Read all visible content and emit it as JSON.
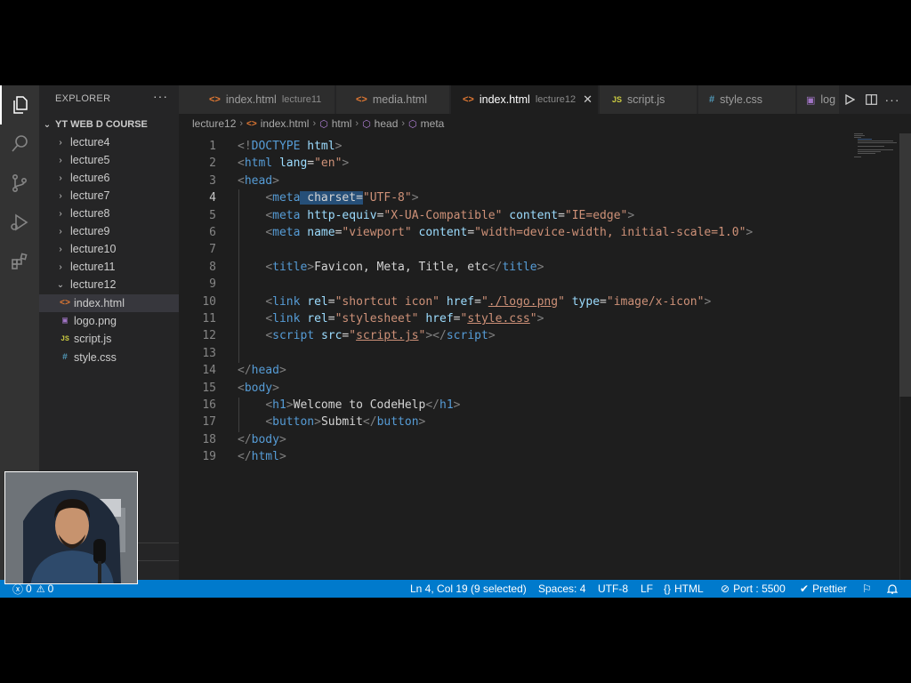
{
  "sidebar": {
    "title": "EXPLORER",
    "more": "···",
    "project": "YT WEB D COURSE",
    "folders": [
      "lecture4",
      "lecture5",
      "lecture6",
      "lecture7",
      "lecture8",
      "lecture9",
      "lecture10",
      "lecture11",
      "lecture12"
    ],
    "files": [
      {
        "name": "index.html",
        "icon": "html-icon",
        "glyph": "<>",
        "color": "#e37933"
      },
      {
        "name": "logo.png",
        "icon": "image-icon",
        "glyph": "▣",
        "color": "#a074c4"
      },
      {
        "name": "script.js",
        "icon": "js-icon",
        "glyph": "JS",
        "color": "#cbcb41"
      },
      {
        "name": "style.css",
        "icon": "css-icon",
        "glyph": "#",
        "color": "#519aba"
      }
    ]
  },
  "tabs": [
    {
      "label": "index.html",
      "desc": "lecture11",
      "glyph": "<>",
      "color": "#e37933",
      "active": false
    },
    {
      "label": "media.html",
      "desc": "",
      "glyph": "<>",
      "color": "#e37933",
      "active": false
    },
    {
      "label": "index.html",
      "desc": "lecture12",
      "glyph": "<>",
      "color": "#e37933",
      "active": true,
      "close": "✕"
    },
    {
      "label": "script.js",
      "desc": "",
      "glyph": "JS",
      "color": "#cbcb41",
      "active": false
    },
    {
      "label": "style.css",
      "desc": "",
      "glyph": "#",
      "color": "#519aba",
      "active": false
    },
    {
      "label": "log",
      "desc": "",
      "glyph": "▣",
      "color": "#a074c4",
      "active": false
    }
  ],
  "breadcrumb": {
    "folder": "lecture12",
    "file": "index.html",
    "html": "html",
    "head": "head",
    "meta": "meta"
  },
  "editor": {
    "lines": [
      {
        "n": "1",
        "tokens": [
          [
            "tg",
            "<!"
          ],
          [
            "tn",
            "DOCTYPE"
          ],
          [
            "tx",
            " "
          ],
          [
            "an",
            "html"
          ],
          [
            "tg",
            ">"
          ]
        ]
      },
      {
        "n": "2",
        "tokens": [
          [
            "tg",
            "<"
          ],
          [
            "tn",
            "html"
          ],
          [
            "tx",
            " "
          ],
          [
            "an",
            "lang"
          ],
          [
            "tx",
            "="
          ],
          [
            "av",
            "\"en\""
          ],
          [
            "tg",
            ">"
          ]
        ]
      },
      {
        "n": "3",
        "tokens": [
          [
            "tg",
            "<"
          ],
          [
            "tn",
            "head"
          ],
          [
            "tg",
            ">"
          ]
        ]
      },
      {
        "n": "4",
        "tokens": [
          [
            "tx",
            "    "
          ],
          [
            "tg",
            "<"
          ],
          [
            "tn",
            "meta"
          ],
          [
            "sel",
            " charset="
          ],
          [
            "av",
            "\"UTF-8\""
          ],
          [
            "tg",
            ">"
          ]
        ]
      },
      {
        "n": "5",
        "tokens": [
          [
            "tx",
            "    "
          ],
          [
            "tg",
            "<"
          ],
          [
            "tn",
            "meta"
          ],
          [
            "tx",
            " "
          ],
          [
            "an",
            "http-equiv"
          ],
          [
            "tx",
            "="
          ],
          [
            "av",
            "\"X-UA-Compatible\""
          ],
          [
            "tx",
            " "
          ],
          [
            "an",
            "content"
          ],
          [
            "tx",
            "="
          ],
          [
            "av",
            "\"IE=edge\""
          ],
          [
            "tg",
            ">"
          ]
        ]
      },
      {
        "n": "6",
        "tokens": [
          [
            "tx",
            "    "
          ],
          [
            "tg",
            "<"
          ],
          [
            "tn",
            "meta"
          ],
          [
            "tx",
            " "
          ],
          [
            "an",
            "name"
          ],
          [
            "tx",
            "="
          ],
          [
            "av",
            "\"viewport\""
          ],
          [
            "tx",
            " "
          ],
          [
            "an",
            "content"
          ],
          [
            "tx",
            "="
          ],
          [
            "av",
            "\"width=device-width, initial-scale=1.0\""
          ],
          [
            "tg",
            ">"
          ]
        ]
      },
      {
        "n": "7",
        "tokens": []
      },
      {
        "n": "8",
        "tokens": [
          [
            "tx",
            "    "
          ],
          [
            "tg",
            "<"
          ],
          [
            "tn",
            "title"
          ],
          [
            "tg",
            ">"
          ],
          [
            "tx",
            "Favicon, Meta, Title, etc"
          ],
          [
            "tg",
            "</"
          ],
          [
            "tn",
            "title"
          ],
          [
            "tg",
            ">"
          ]
        ]
      },
      {
        "n": "9",
        "tokens": []
      },
      {
        "n": "10",
        "tokens": [
          [
            "tx",
            "    "
          ],
          [
            "tg",
            "<"
          ],
          [
            "tn",
            "link"
          ],
          [
            "tx",
            " "
          ],
          [
            "an",
            "rel"
          ],
          [
            "tx",
            "="
          ],
          [
            "av",
            "\"shortcut icon\""
          ],
          [
            "tx",
            " "
          ],
          [
            "an",
            "href"
          ],
          [
            "tx",
            "="
          ],
          [
            "av",
            "\""
          ],
          [
            "lk",
            "./logo.png"
          ],
          [
            "av",
            "\""
          ],
          [
            "tx",
            " "
          ],
          [
            "an",
            "type"
          ],
          [
            "tx",
            "="
          ],
          [
            "av",
            "\"image/x-icon\""
          ],
          [
            "tg",
            ">"
          ]
        ]
      },
      {
        "n": "11",
        "tokens": [
          [
            "tx",
            "    "
          ],
          [
            "tg",
            "<"
          ],
          [
            "tn",
            "link"
          ],
          [
            "tx",
            " "
          ],
          [
            "an",
            "rel"
          ],
          [
            "tx",
            "="
          ],
          [
            "av",
            "\"stylesheet\""
          ],
          [
            "tx",
            " "
          ],
          [
            "an",
            "href"
          ],
          [
            "tx",
            "="
          ],
          [
            "av",
            "\""
          ],
          [
            "lk",
            "style.css"
          ],
          [
            "av",
            "\""
          ],
          [
            "tg",
            ">"
          ]
        ]
      },
      {
        "n": "12",
        "tokens": [
          [
            "tx",
            "    "
          ],
          [
            "tg",
            "<"
          ],
          [
            "tn",
            "script"
          ],
          [
            "tx",
            " "
          ],
          [
            "an",
            "src"
          ],
          [
            "tx",
            "="
          ],
          [
            "av",
            "\""
          ],
          [
            "lk",
            "script.js"
          ],
          [
            "av",
            "\""
          ],
          [
            "tg",
            "></"
          ],
          [
            "tn",
            "script"
          ],
          [
            "tg",
            ">"
          ]
        ]
      },
      {
        "n": "13",
        "tokens": []
      },
      {
        "n": "14",
        "tokens": [
          [
            "tg",
            "</"
          ],
          [
            "tn",
            "head"
          ],
          [
            "tg",
            ">"
          ]
        ]
      },
      {
        "n": "15",
        "tokens": [
          [
            "tg",
            "<"
          ],
          [
            "tn",
            "body"
          ],
          [
            "tg",
            ">"
          ]
        ]
      },
      {
        "n": "16",
        "tokens": [
          [
            "tx",
            "    "
          ],
          [
            "tg",
            "<"
          ],
          [
            "tn",
            "h1"
          ],
          [
            "tg",
            ">"
          ],
          [
            "tx",
            "Welcome to CodeHelp"
          ],
          [
            "tg",
            "</"
          ],
          [
            "tn",
            "h1"
          ],
          [
            "tg",
            ">"
          ]
        ]
      },
      {
        "n": "17",
        "tokens": [
          [
            "tx",
            "    "
          ],
          [
            "tg",
            "<"
          ],
          [
            "tn",
            "button"
          ],
          [
            "tg",
            ">"
          ],
          [
            "tx",
            "Submit"
          ],
          [
            "tg",
            "</"
          ],
          [
            "tn",
            "button"
          ],
          [
            "tg",
            ">"
          ]
        ]
      },
      {
        "n": "18",
        "tokens": [
          [
            "tg",
            "</"
          ],
          [
            "tn",
            "body"
          ],
          [
            "tg",
            ">"
          ]
        ]
      },
      {
        "n": "19",
        "tokens": [
          [
            "tg",
            "</"
          ],
          [
            "tn",
            "html"
          ],
          [
            "tg",
            ">"
          ]
        ]
      }
    ],
    "current_line": "4"
  },
  "statusbar": {
    "errors": "0",
    "warnings": "0",
    "position": "Ln 4, Col 19 (9 selected)",
    "spaces": "Spaces: 4",
    "encoding": "UTF-8",
    "eol": "LF",
    "language": "HTML",
    "port": "Port : 5500",
    "formatter": "Prettier"
  },
  "colors": {
    "statusbar": "#007acc",
    "editor_bg": "#1e1e1e",
    "sidebar_bg": "#252526",
    "activity_bg": "#333333"
  }
}
